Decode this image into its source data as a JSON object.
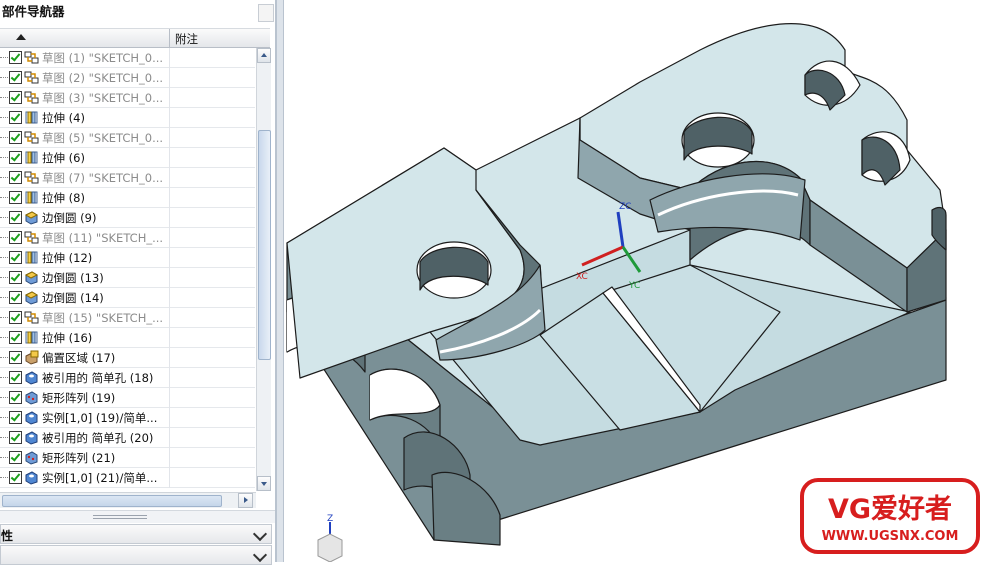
{
  "navigator": {
    "title": "部件导航器",
    "sort_indicator": "ascending",
    "note_column": "附注",
    "rows": [
      {
        "label": "草图 (1) \"SKETCH_0...",
        "icon": "sketch-icon",
        "dim": true
      },
      {
        "label": "草图 (2) \"SKETCH_0...",
        "icon": "sketch-icon",
        "dim": true
      },
      {
        "label": "草图 (3) \"SKETCH_0...",
        "icon": "sketch-icon",
        "dim": true
      },
      {
        "label": "拉伸 (4)",
        "icon": "extrude-icon",
        "dim": false
      },
      {
        "label": "草图 (5) \"SKETCH_0...",
        "icon": "sketch-icon",
        "dim": true
      },
      {
        "label": "拉伸 (6)",
        "icon": "extrude-icon",
        "dim": false
      },
      {
        "label": "草图 (7) \"SKETCH_0...",
        "icon": "sketch-icon",
        "dim": true
      },
      {
        "label": "拉伸 (8)",
        "icon": "extrude-icon",
        "dim": false
      },
      {
        "label": "边倒圆 (9)",
        "icon": "edge-blend-icon",
        "dim": false
      },
      {
        "label": "草图 (11) \"SKETCH_...",
        "icon": "sketch-icon",
        "dim": true
      },
      {
        "label": "拉伸 (12)",
        "icon": "extrude-icon",
        "dim": false
      },
      {
        "label": "边倒圆 (13)",
        "icon": "edge-blend-icon",
        "dim": false
      },
      {
        "label": "边倒圆 (14)",
        "icon": "edge-blend-icon",
        "dim": false
      },
      {
        "label": "草图 (15) \"SKETCH_...",
        "icon": "sketch-icon",
        "dim": true
      },
      {
        "label": "拉伸 (16)",
        "icon": "extrude-icon",
        "dim": false
      },
      {
        "label": "偏置区域 (17)",
        "icon": "offset-region-icon",
        "dim": false
      },
      {
        "label": "被引用的 简单孔 (18)",
        "icon": "hole-icon",
        "dim": false
      },
      {
        "label": "矩形阵列 (19)",
        "icon": "pattern-icon",
        "dim": false
      },
      {
        "label": "实例[1,0] (19)/简单...",
        "icon": "hole-icon",
        "dim": false
      },
      {
        "label": "被引用的 简单孔 (20)",
        "icon": "hole-icon",
        "dim": false
      },
      {
        "label": "矩形阵列 (21)",
        "icon": "pattern-icon",
        "dim": false
      },
      {
        "label": "实例[1,0] (21)/简单...",
        "icon": "hole-icon",
        "dim": false
      }
    ]
  },
  "panels": {
    "properties_title": "性",
    "second_title": ""
  },
  "viewport": {
    "axis_labels": {
      "zc": "ZC",
      "xc": "XC",
      "yc": "YC",
      "z": "Z"
    },
    "model_color": "#d3e6ea",
    "edge_color": "#1c1c1c"
  },
  "watermark": {
    "brand": "VG爱好者",
    "url": "WWW.UGSNX.COM",
    "color": "#d71e1e"
  }
}
